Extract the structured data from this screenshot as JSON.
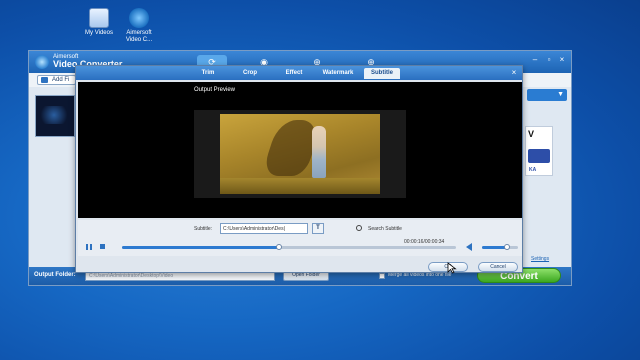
{
  "desktop": {
    "icons": [
      {
        "label_line1": "My Videos",
        "label_line2": ""
      },
      {
        "label_line1": "Aimersoft",
        "label_line2": "Video C..."
      }
    ]
  },
  "main_window": {
    "brand_small": "Aimersoft",
    "brand_large": "Video Converter",
    "add_files_label": "Add Fi",
    "right_select_value": "▼",
    "format_badge": "V",
    "format_sub": "KA",
    "settings_label": "Settings",
    "output_folder_label": "Output Folder:",
    "output_path": "C:\\Users\\Administrator\\Desktop\\Video",
    "open_folder_label": "Open Folder",
    "merge_label": "Merge all videos into one file",
    "convert_label": "Convert",
    "window_controls": [
      "–",
      "▫",
      "×"
    ]
  },
  "edit_dialog": {
    "tabs": [
      "Trim",
      "Crop",
      "Effect",
      "Watermark",
      "Subtitle"
    ],
    "active_tab": "Subtitle",
    "close_label": "×",
    "preview_label": "Output Preview",
    "subtitle_label": "Subtitle:",
    "subtitle_value": "C:\\Users\\Administrator\\Des|",
    "font_button_label": "T",
    "search_subtitle_label": "Search Subtitle",
    "timecode": "00:00:16/00:00:34",
    "seek_progress": 0.47,
    "volume_level": 0.7,
    "ok_label": "OK",
    "cancel_label": "Cancel"
  },
  "colors": {
    "desktop_bg": "#1668c4",
    "title_bar": "#2a6fc0",
    "convert_green": "#3ca820",
    "accent_blue": "#2d7ad0"
  }
}
